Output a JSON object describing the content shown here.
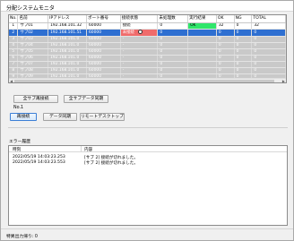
{
  "window": {
    "title": "分配システムモニタ"
  },
  "grid": {
    "columns": [
      "No.",
      "名前",
      "IPアドレス",
      "ポート番号",
      "接続状態",
      "未処理数",
      "実行結果",
      "OK",
      "NG",
      "TOTAL"
    ],
    "rows": [
      {
        "no": "1",
        "name": "サブ01",
        "ip": "192.168.101.32",
        "port": "60000",
        "state": "接続",
        "pending": "0",
        "result": "OK",
        "ok": "32",
        "ng": "0",
        "total": "32",
        "style": "active"
      },
      {
        "no": "2",
        "name": "サブ02",
        "ip": "192.168.101.51",
        "port": "60000",
        "state": "未接続",
        "pending": "0",
        "result": "",
        "ok": "0",
        "ng": "0",
        "total": "0",
        "style": "selected"
      },
      {
        "no": "3",
        "name": "サブ03",
        "ip": "192.168.101.0",
        "port": "60000",
        "state": "-",
        "pending": "0",
        "result": "",
        "ok": "0",
        "ng": "0",
        "total": "0",
        "style": "disabled"
      },
      {
        "no": "4",
        "name": "サブ04",
        "ip": "192.168.101.0",
        "port": "60000",
        "state": "-",
        "pending": "0",
        "result": "",
        "ok": "0",
        "ng": "0",
        "total": "0",
        "style": "disabled"
      },
      {
        "no": "5",
        "name": "サブ05",
        "ip": "192.168.101.0",
        "port": "60000",
        "state": "-",
        "pending": "0",
        "result": "",
        "ok": "0",
        "ng": "0",
        "total": "0",
        "style": "disabled"
      },
      {
        "no": "6",
        "name": "サブ06",
        "ip": "192.168.101.0",
        "port": "60000",
        "state": "-",
        "pending": "0",
        "result": "",
        "ok": "0",
        "ng": "0",
        "total": "0",
        "style": "disabled"
      },
      {
        "no": "7",
        "name": "サブ07",
        "ip": "192.168.101.0",
        "port": "60000",
        "state": "-",
        "pending": "0",
        "result": "",
        "ok": "0",
        "ng": "0",
        "total": "0",
        "style": "disabled"
      },
      {
        "no": "8",
        "name": "サブ08",
        "ip": "192.168.101.0",
        "port": "60000",
        "state": "-",
        "pending": "0",
        "result": "",
        "ok": "0",
        "ng": "0",
        "total": "0",
        "style": "disabled"
      },
      {
        "no": "9",
        "name": "サブ09",
        "ip": "192.168.101.0",
        "port": "60000",
        "state": "-",
        "pending": "0",
        "result": "",
        "ok": "0",
        "ng": "0",
        "total": "0",
        "style": "disabled"
      },
      {
        "no": "10",
        "name": "サブ10",
        "ip": "192.168.101.0",
        "port": "60000",
        "state": "-",
        "pending": "0",
        "result": "",
        "ok": "0",
        "ng": "0",
        "total": "0",
        "style": "disabled"
      }
    ]
  },
  "controls": {
    "all_reconnect": "全サブ再接続",
    "all_disconnect": "全サブデータ同期",
    "selected_label": "No.1",
    "reconnect": "再接続",
    "data_sync": "データ同期",
    "remote_desktop": "リモートデスクトップ"
  },
  "errors": {
    "label": "エラー履歴",
    "col_time": "時刻",
    "col_msg": "内容",
    "rows": [
      {
        "time": "2022/05/19 14:03:23.253",
        "msg": "[サブ 2] 接続が切れました。"
      },
      {
        "time": "2022/05/19 14:03:23.553",
        "msg": "[サブ 2] 接続が切れました。"
      }
    ]
  },
  "status": {
    "text": "特異出力帰り: 0"
  },
  "colors": {
    "ok": "#2fe66b",
    "err": "#f06b6b",
    "selected": "#2e6fd1",
    "disabled": "#c9c9c9"
  }
}
